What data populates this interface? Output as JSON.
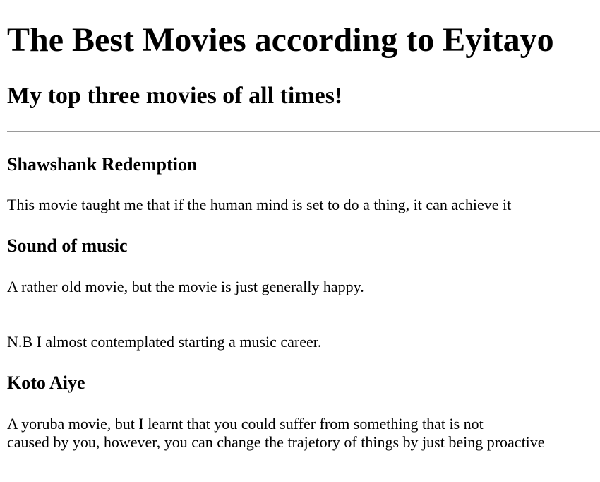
{
  "page": {
    "title": "The Best Movies according to Eyitayo",
    "subtitle": "My top three movies of all times!"
  },
  "movies": [
    {
      "title": "Shawshank Redemption",
      "description": "This movie taught me that if the human mind is set to do a thing, it can achieve it"
    },
    {
      "title": "Sound of music",
      "description": "A rather old movie, but the movie is just generally happy.",
      "note": "N.B I almost contemplated starting a music career."
    },
    {
      "title": "Koto Aiye",
      "description_lines": [
        "A yoruba movie, but I learnt that you could suffer from something that is not",
        "caused by you, however, you can change the trajetory of things by just being proactive"
      ]
    }
  ]
}
